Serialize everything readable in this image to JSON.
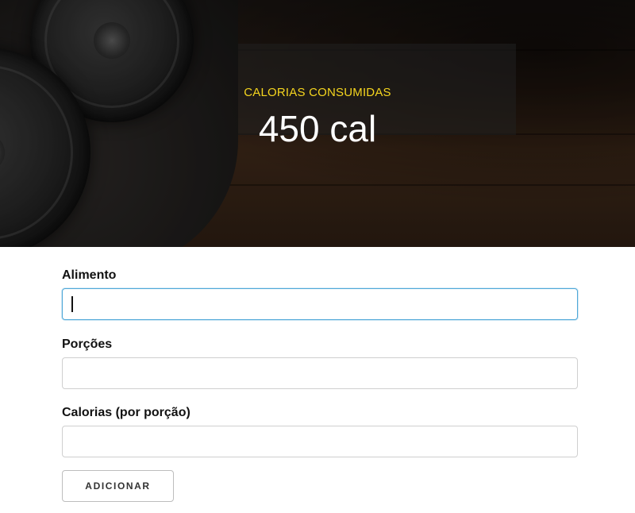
{
  "hero": {
    "label": "CALORIAS CONSUMIDAS",
    "value": "450 cal",
    "label_color": "#f5d51e"
  },
  "form": {
    "fields": [
      {
        "label": "Alimento",
        "value": "",
        "placeholder": ""
      },
      {
        "label": "Porções",
        "value": "",
        "placeholder": ""
      },
      {
        "label": "Calorias (por porção)",
        "value": "",
        "placeholder": ""
      }
    ],
    "submit_label": "ADICIONAR",
    "focus_color": "#4fa8d8"
  }
}
